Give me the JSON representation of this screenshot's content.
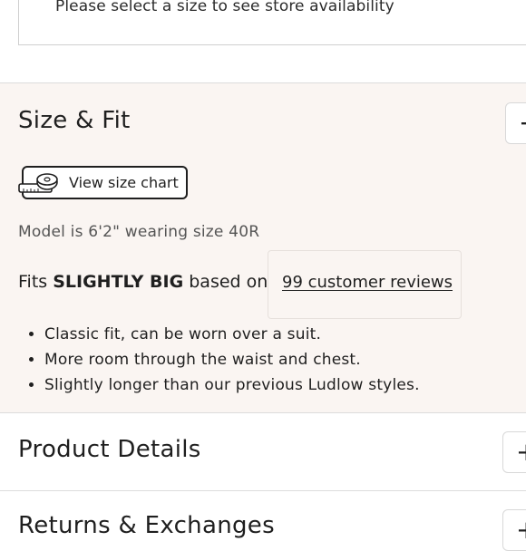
{
  "store": {
    "availability_message": "Please select a size to see store availability"
  },
  "size_fit": {
    "title": "Size & Fit",
    "toggle_icon": "−",
    "size_chart_label": "View size chart",
    "model_info": "Model is 6'2\" wearing size 40R",
    "fits_prefix": "Fits ",
    "fits_value": "SLIGHTLY BIG",
    "fits_suffix": " based on",
    "reviews_link": "99 customer reviews",
    "bullets": [
      "Classic fit, can be worn over a suit.",
      "More room through the waist and chest.",
      "Slightly longer than our previous Ludlow styles."
    ]
  },
  "product_details": {
    "title": "Product Details",
    "toggle_icon": "+"
  },
  "returns": {
    "title": "Returns & Exchanges",
    "toggle_icon": "+"
  },
  "colors": {
    "section_bg": "#faf5f2",
    "text": "#1f1f1f",
    "muted_text": "#555555",
    "border": "#d8d8d8"
  }
}
